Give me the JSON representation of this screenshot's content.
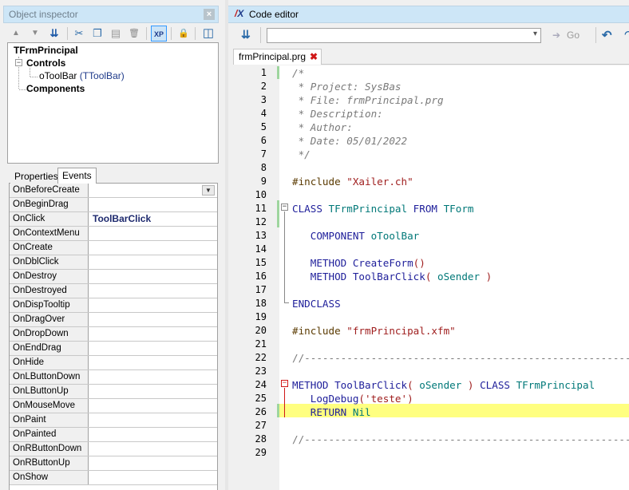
{
  "object_inspector": {
    "title": "Object inspector",
    "close": "×",
    "toolbar": [
      {
        "name": "move-up-icon",
        "glyph": "▲"
      },
      {
        "name": "move-down-icon",
        "glyph": "▼"
      },
      {
        "name": "sort-icon",
        "glyph": "⇊"
      },
      {
        "name": "cut-icon",
        "glyph": "✂"
      },
      {
        "name": "copy-icon",
        "glyph": "❐"
      },
      {
        "name": "paste-icon",
        "glyph": "▤"
      },
      {
        "name": "delete-icon",
        "glyph": "🗑"
      },
      {
        "name": "xp-style-icon",
        "glyph": "XP"
      },
      {
        "name": "lock-icon",
        "glyph": "🔒"
      },
      {
        "name": "layout-icon",
        "glyph": "◫"
      }
    ],
    "tree": {
      "root": "TFrmPrincipal",
      "controls": "Controls",
      "child_name": "oToolBar",
      "child_class": "(TToolBar)",
      "components": "Components"
    },
    "tabs": {
      "properties": "Properties",
      "events": "Events"
    },
    "events": [
      {
        "name": "OnBeforeCreate",
        "value": ""
      },
      {
        "name": "OnBeginDrag",
        "value": ""
      },
      {
        "name": "OnClick",
        "value": "ToolBarClick"
      },
      {
        "name": "OnContextMenu",
        "value": ""
      },
      {
        "name": "OnCreate",
        "value": ""
      },
      {
        "name": "OnDblClick",
        "value": ""
      },
      {
        "name": "OnDestroy",
        "value": ""
      },
      {
        "name": "OnDestroyed",
        "value": ""
      },
      {
        "name": "OnDispTooltip",
        "value": ""
      },
      {
        "name": "OnDragOver",
        "value": ""
      },
      {
        "name": "OnDropDown",
        "value": ""
      },
      {
        "name": "OnEndDrag",
        "value": ""
      },
      {
        "name": "OnHide",
        "value": ""
      },
      {
        "name": "OnLButtonDown",
        "value": ""
      },
      {
        "name": "OnLButtonUp",
        "value": ""
      },
      {
        "name": "OnMouseMove",
        "value": ""
      },
      {
        "name": "OnPaint",
        "value": ""
      },
      {
        "name": "OnPainted",
        "value": ""
      },
      {
        "name": "OnRButtonDown",
        "value": ""
      },
      {
        "name": "OnRButtonUp",
        "value": ""
      },
      {
        "name": "OnShow",
        "value": ""
      }
    ]
  },
  "code_editor": {
    "logo": "X",
    "title": "Code editor",
    "go_label": "Go",
    "file_tab": "frmPrincipal.prg",
    "current_line": 26,
    "lines": [
      {
        "n": "1",
        "seg": [
          [
            "c",
            "/*"
          ]
        ]
      },
      {
        "n": "2",
        "seg": [
          [
            "c",
            " * Project: SysBas"
          ]
        ]
      },
      {
        "n": "3",
        "seg": [
          [
            "c",
            " * File: frmPrincipal.prg"
          ]
        ]
      },
      {
        "n": "4",
        "seg": [
          [
            "c",
            " * Description:"
          ]
        ]
      },
      {
        "n": "5",
        "seg": [
          [
            "c",
            " * Author:"
          ]
        ]
      },
      {
        "n": "6",
        "seg": [
          [
            "c",
            " * Date: 05/01/2022"
          ]
        ]
      },
      {
        "n": "7",
        "seg": [
          [
            "c",
            " */"
          ]
        ]
      },
      {
        "n": "8",
        "seg": []
      },
      {
        "n": "9",
        "seg": [
          [
            "pp",
            "#include "
          ],
          [
            "str",
            "\"Xailer.ch\""
          ]
        ]
      },
      {
        "n": "10",
        "seg": []
      },
      {
        "n": "11",
        "seg": [
          [
            "kw",
            "CLASS "
          ],
          [
            "id",
            "TFrmPrincipal "
          ],
          [
            "kw",
            "FROM "
          ],
          [
            "id",
            "TForm"
          ]
        ]
      },
      {
        "n": "12",
        "seg": []
      },
      {
        "n": "13",
        "seg": [
          [
            "kw",
            "   COMPONENT "
          ],
          [
            "id",
            "oToolBar"
          ]
        ]
      },
      {
        "n": "14",
        "seg": []
      },
      {
        "n": "15",
        "seg": [
          [
            "kw",
            "   METHOD "
          ],
          [
            "fn",
            "CreateForm"
          ],
          [
            "pr",
            "()"
          ]
        ]
      },
      {
        "n": "16",
        "seg": [
          [
            "kw",
            "   METHOD "
          ],
          [
            "fn",
            "ToolBarClick"
          ],
          [
            "pr",
            "( "
          ],
          [
            "id",
            "oSender "
          ],
          [
            "pr",
            ")"
          ]
        ]
      },
      {
        "n": "17",
        "seg": []
      },
      {
        "n": "18",
        "seg": [
          [
            "kw",
            "ENDCLASS"
          ]
        ]
      },
      {
        "n": "19",
        "seg": []
      },
      {
        "n": "20",
        "seg": [
          [
            "pp",
            "#include "
          ],
          [
            "str",
            "\"frmPrincipal.xfm\""
          ]
        ]
      },
      {
        "n": "21",
        "seg": []
      },
      {
        "n": "22",
        "seg": [
          [
            "gr",
            "//------------------------------------------------------------"
          ]
        ]
      },
      {
        "n": "23",
        "seg": []
      },
      {
        "n": "24",
        "seg": [
          [
            "kw",
            "METHOD "
          ],
          [
            "fn",
            "ToolBarClick"
          ],
          [
            "pr",
            "( "
          ],
          [
            "id",
            "oSender "
          ],
          [
            "pr",
            ") "
          ],
          [
            "kw",
            "CLASS "
          ],
          [
            "id",
            "TFrmPrincipal"
          ]
        ]
      },
      {
        "n": "25",
        "seg": [
          [
            "fn",
            "   LogDebug"
          ],
          [
            "pr",
            "('teste')"
          ]
        ]
      },
      {
        "n": "26",
        "seg": [
          [
            "kw",
            "   RETURN "
          ],
          [
            "id",
            "Nil"
          ]
        ]
      },
      {
        "n": "27",
        "seg": []
      },
      {
        "n": "28",
        "seg": [
          [
            "gr",
            "//------------------------------------------------------------"
          ]
        ]
      },
      {
        "n": "29",
        "seg": []
      }
    ]
  }
}
